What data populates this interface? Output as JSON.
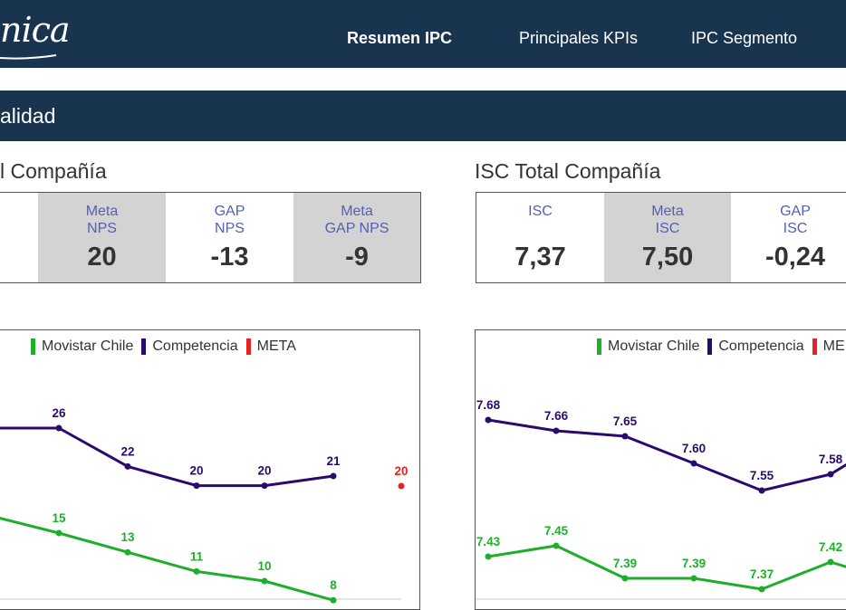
{
  "header": {
    "logo_text": "nica",
    "nav": [
      {
        "label": "Resumen IPC",
        "active": true
      },
      {
        "label": "Principales KPIs",
        "active": false
      },
      {
        "label": "IPC Segmento",
        "active": false
      }
    ]
  },
  "section": {
    "title": "alidad"
  },
  "nps_panel": {
    "title": "l Compañía",
    "cards": [
      {
        "label": "Meta\nNPS",
        "value": "20"
      },
      {
        "label": "GAP\nNPS",
        "value": "-13"
      },
      {
        "label": "Meta\nGAP NPS",
        "value": "-9"
      }
    ]
  },
  "isc_panel": {
    "title": "ISC Total Compañía",
    "cards": [
      {
        "label": "ISC",
        "value": "7,37"
      },
      {
        "label": "Meta\nISC",
        "value": "7,50"
      },
      {
        "label": "GAP\nISC",
        "value": "-0,24"
      }
    ]
  },
  "colors": {
    "navy": "#18344f",
    "movistar": "#1fae2b",
    "competencia": "#2b0a6e",
    "meta": "#e42424",
    "kpi_label": "#5560b0"
  },
  "chart_data": [
    {
      "type": "line",
      "legend": [
        "Movistar Chile",
        "Competencia",
        "META"
      ],
      "series": [
        {
          "name": "Competencia",
          "values": [
            26,
            22,
            20,
            20,
            21
          ],
          "labels": [
            "26",
            "22",
            "20",
            "20",
            "21"
          ]
        },
        {
          "name": "Movistar Chile",
          "values": [
            15,
            13,
            11,
            10,
            8
          ],
          "labels": [
            "15",
            "13",
            "11",
            "10",
            "8"
          ]
        },
        {
          "name": "META",
          "values": [
            20
          ],
          "labels": [
            "20"
          ]
        }
      ]
    },
    {
      "type": "line",
      "legend": [
        "Movistar Chile",
        "Competencia",
        "ME"
      ],
      "series": [
        {
          "name": "Competencia",
          "values": [
            7.68,
            7.66,
            7.65,
            7.6,
            7.55,
            7.58
          ],
          "labels": [
            "7.68",
            "7.66",
            "7.65",
            "7.60",
            "7.55",
            "7.58"
          ]
        },
        {
          "name": "Movistar Chile",
          "values": [
            7.43,
            7.45,
            7.39,
            7.39,
            7.37,
            7.42
          ],
          "labels": [
            "7.43",
            "7.45",
            "7.39",
            "7.39",
            "7.37",
            "7.42"
          ]
        }
      ]
    }
  ]
}
